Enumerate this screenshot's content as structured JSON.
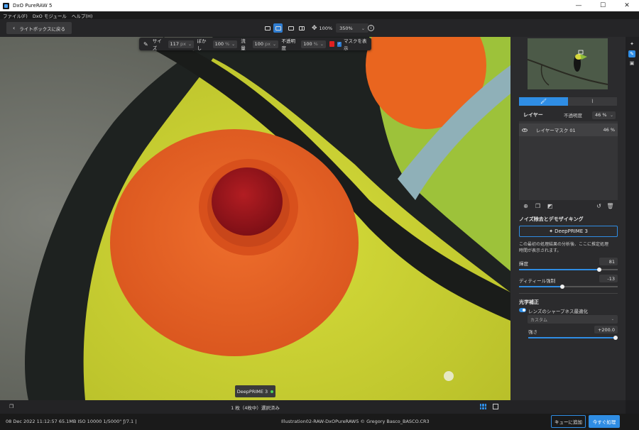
{
  "window": {
    "title": "DxO PureRAW 5",
    "minimize": "—",
    "maximize": "☐",
    "close": "✕"
  },
  "menu": [
    "ファイル(F)",
    "DxO モジュール",
    "ヘルプ(H)"
  ],
  "toolbar": {
    "back_label": "ライトボックスに戻る",
    "zoom_fit": "100%",
    "zoom_level": "350%",
    "zoom_chevron": "⌄",
    "info": "i"
  },
  "brush": {
    "size_label": "サイズ",
    "size_value": "117",
    "size_unit": "px",
    "feather_label": "ぼかし",
    "feather_value": "100",
    "feather_unit": "%",
    "flow_label": "流量",
    "flow_value": "100",
    "flow_unit": "px",
    "opacity_label": "不透明度",
    "opacity_value": "100",
    "opacity_unit": "%",
    "mask_color": "#e02020",
    "show_mask_label": "マスクを表示",
    "show_mask_checked": true
  },
  "image_badge": "DeepPRIME 3",
  "panel": {
    "tabs": [
      {
        "icon": "brush-icon",
        "glyph": "🖌",
        "active": true
      },
      {
        "icon": "eraser-brush-icon",
        "glyph": "⌇",
        "active": false
      }
    ],
    "layer_title": "レイヤー",
    "opacity_label": "不透明度",
    "opacity_value": "46 %",
    "layers": [
      {
        "name": "レイヤーマスク 01",
        "value": "46 %"
      }
    ],
    "noise_section_title": "ノイズ除去とデモザイキング",
    "deepprime_button": "✦ DeepPRIME 3",
    "description": "この最初の処理結果の分析後、ここに推定処理時間が表示されます。",
    "luminance_label": "輝度",
    "luminance_value": "81",
    "luminance_fraction": 0.81,
    "detail_label": "ディティール強制",
    "detail_value": "-13",
    "detail_fraction": 0.44,
    "optics_section_title": "光学補正",
    "sharpness_label": "レンズのシャープネス最適化",
    "sharpness_enabled": true,
    "sharpness_mode": "カスタム",
    "strength_label": "強さ",
    "strength_value": "+200.0",
    "strength_fraction": 1.0
  },
  "filmstrip": {
    "selection_text": "1 枚（4枚中）選択済み"
  },
  "status": {
    "meta": "08 Dec 2022 11:12:57   65.1MB   ISO 10000   1/5000\"   ƒ/7.1   |",
    "file": "Illustration02-RAW-DxOPureRAW5 ©  Gregory Basco_BASCO.CR3",
    "queue_button": "キューに追加",
    "process_button": "今すぐ処理"
  },
  "colors": {
    "accent": "#2f8de4",
    "panel_bg": "#2b2b2d"
  }
}
